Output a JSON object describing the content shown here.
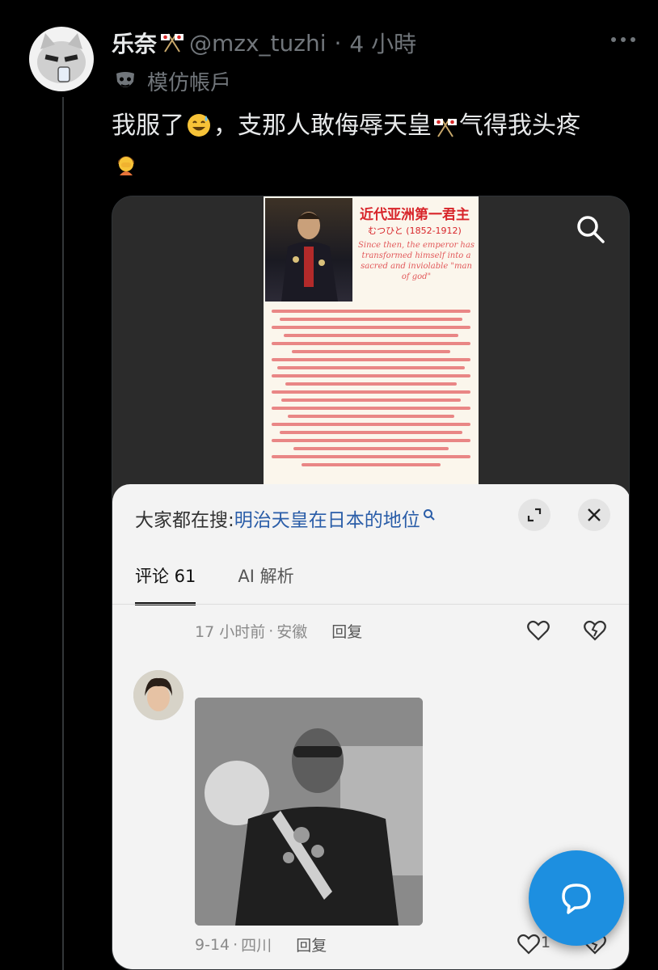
{
  "post": {
    "display_name": "乐奈",
    "handle": "@mzx_tuzhi",
    "dot": "·",
    "time": "4 小時",
    "parody_label": "模仿帳戶",
    "text_part1": "我服了",
    "text_part2": "，支那人敢侮辱天皇",
    "text_part3": "气得我头疼"
  },
  "poster": {
    "title": "近代亚洲第一君主",
    "subtitle": "むつひと (1852-1912)",
    "english": "Since then, the emperor has transformed himself into a sacred and inviolable \"man of god\""
  },
  "sheet": {
    "search_prefix": "大家都在搜:",
    "search_term": "明治天皇在日本的地位",
    "tabs": [
      "评论 61",
      "AI 解析"
    ]
  },
  "comments": [
    {
      "time": "17 小时前",
      "sep": "·",
      "location": "安徽",
      "reply": "回复",
      "likes": ""
    },
    {
      "time": "9-14",
      "sep": "·",
      "location": "四川",
      "reply": "回复",
      "likes": "1"
    }
  ],
  "colors": {
    "accent": "#1d8fe0",
    "link": "#2a5da8",
    "poster_red": "#d8252a"
  }
}
